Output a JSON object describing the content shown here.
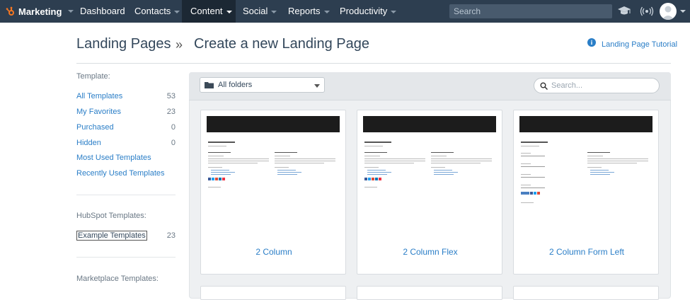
{
  "nav": {
    "brand": "Marketing",
    "items": [
      {
        "label": "Dashboard"
      },
      {
        "label": "Contacts"
      },
      {
        "label": "Content"
      },
      {
        "label": "Social"
      },
      {
        "label": "Reports"
      },
      {
        "label": "Productivity"
      }
    ],
    "search_placeholder": "Search"
  },
  "header": {
    "crumb_parent": "Landing Pages",
    "separator": "»",
    "title": "Create a new Landing Page",
    "tutorial_label": "Landing Page Tutorial"
  },
  "sidebar": {
    "template_heading": "Template:",
    "items": [
      {
        "label": "All Templates",
        "count": "53"
      },
      {
        "label": "My Favorites",
        "count": "23"
      },
      {
        "label": "Purchased",
        "count": "0"
      },
      {
        "label": "Hidden",
        "count": "0"
      },
      {
        "label": "Most Used Templates",
        "count": ""
      },
      {
        "label": "Recently Used Templates",
        "count": ""
      }
    ],
    "hubspot_heading": "HubSpot Templates:",
    "hubspot_item": {
      "label": "Example Templates",
      "count": "23"
    },
    "marketplace_heading": "Marketplace Templates:"
  },
  "toolbar": {
    "folder_value": "All folders",
    "search_placeholder": "Search..."
  },
  "cards": [
    {
      "label": "2 Column"
    },
    {
      "label": "2 Column Flex"
    },
    {
      "label": "2 Column Form Left"
    }
  ],
  "colors": {
    "nav_bg": "#2d3e50",
    "link": "#2a7ec7",
    "hubspot_orange": "#f57722"
  }
}
